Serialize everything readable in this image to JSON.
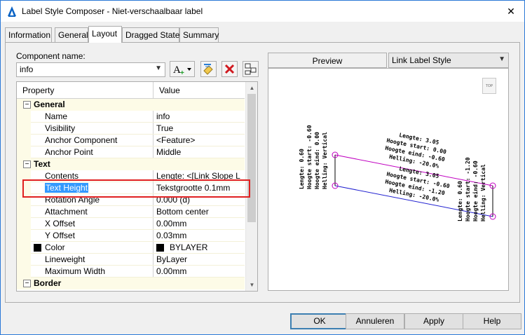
{
  "window": {
    "title": "Label Style Composer - Niet-verschaalbaar label",
    "close": "✕"
  },
  "tabs": [
    {
      "label": "Information",
      "active": false
    },
    {
      "label": "General",
      "active": false
    },
    {
      "label": "Layout",
      "active": true
    },
    {
      "label": "Dragged State",
      "active": false
    },
    {
      "label": "Summary",
      "active": false
    }
  ],
  "component": {
    "label": "Component name:",
    "value": "info"
  },
  "toolbar": {
    "icons": [
      "add-component-icon",
      "copy-component-icon",
      "delete-component-icon",
      "component-order-icon"
    ]
  },
  "grid": {
    "headers": {
      "property": "Property",
      "value": "Value"
    },
    "categories": {
      "general": "General",
      "text": "Text",
      "border": "Border"
    },
    "rows": {
      "name": {
        "label": "Name",
        "value": "info"
      },
      "visibility": {
        "label": "Visibility",
        "value": "True"
      },
      "anchor_component": {
        "label": "Anchor Component",
        "value": "<Feature>"
      },
      "anchor_point": {
        "label": "Anchor Point",
        "value": "Middle"
      },
      "contents": {
        "label": "Contents",
        "value": "Lengte: <[Link Slope L"
      },
      "text_height": {
        "label": "Text Height",
        "value": "Tekstgrootte 0.1mm"
      },
      "rotation_angle": {
        "label": "Rotation Angle",
        "value": "0.000 (d)"
      },
      "attachment": {
        "label": "Attachment",
        "value": "Bottom center"
      },
      "x_offset": {
        "label": "X Offset",
        "value": "0.00mm"
      },
      "y_offset": {
        "label": "Y Offset",
        "value": "0.03mm"
      },
      "color": {
        "label": "Color",
        "value": "BYLAYER"
      },
      "lineweight": {
        "label": "Lineweight",
        "value": "ByLayer"
      },
      "max_width": {
        "label": "Maximum Width",
        "value": "0.00mm"
      }
    }
  },
  "preview": {
    "label": "Preview",
    "style": "Link Label Style",
    "top_button": "TOP",
    "labels": {
      "left_vertical": [
        "Lengte: 0.60",
        "Hoogte start: -0.60",
        "Hoogte eind: 0.00",
        "Helling: Vertical"
      ],
      "top_slope": [
        "Lengte: 3.05",
        "Hoogte start: 0.00",
        "Hoogte eind: -0.60",
        "Helling: -20.0%"
      ],
      "bottom_slope": [
        "Lengte: 3.05",
        "Hoogte start: -0.60",
        "Hoogte eind: -1.20",
        "Helling: -20.0%"
      ],
      "right_vertical": [
        "Lengte: 0.60",
        "Hoogte start: -1.20",
        "Hoogte eind: -0.60",
        "Helling: Vertical"
      ]
    }
  },
  "buttons": {
    "ok": "OK",
    "cancel": "Annuleren",
    "apply": "Apply",
    "help": "Help"
  }
}
